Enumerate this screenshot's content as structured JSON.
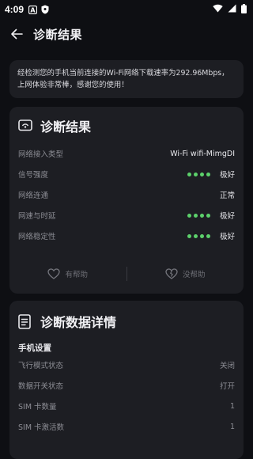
{
  "status_bar": {
    "time": "4:09"
  },
  "app_bar": {
    "title": "诊断结果"
  },
  "message": {
    "text": "经检测您的手机当前连接的Wi-Fi网络下载速率为292.96Mbps，上网体验非常棒，感谢您的使用！"
  },
  "result_card": {
    "title": "诊断结果",
    "rows": [
      {
        "label": "网络接入类型",
        "value": "Wi-Fi wifi-MimgDI",
        "dots": false
      },
      {
        "label": "信号强度",
        "value": "极好",
        "dots": true
      },
      {
        "label": "网络连通",
        "value": "正常",
        "dots": false
      },
      {
        "label": "网速与时延",
        "value": "极好",
        "dots": true
      },
      {
        "label": "网络稳定性",
        "value": "极好",
        "dots": true
      }
    ],
    "helpful_label": "有帮助",
    "not_helpful_label": "没帮助"
  },
  "detail_card": {
    "title": "诊断数据详情",
    "section_title": "手机设置",
    "rows": [
      {
        "label": "飞行模式状态",
        "value": "关闭"
      },
      {
        "label": "数据开关状态",
        "value": "打开"
      },
      {
        "label": "SIM 卡数量",
        "value": "1"
      },
      {
        "label": "SIM 卡激活数",
        "value": "1"
      }
    ]
  },
  "colors": {
    "accent_green": "#5cd16b",
    "card_bg": "#1d1e23",
    "page_bg": "#0e0f13"
  }
}
